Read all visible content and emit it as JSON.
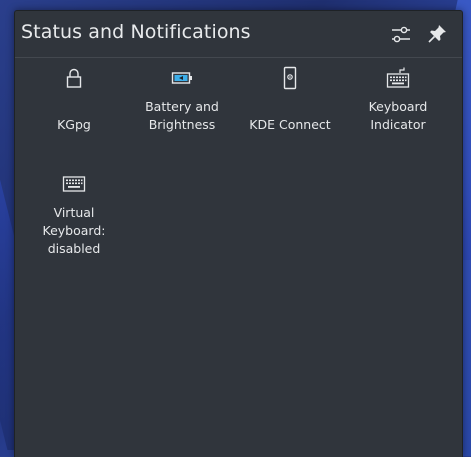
{
  "header": {
    "title": "Status and Notifications",
    "configure_icon": "configure-icon",
    "pin_icon": "pin-icon"
  },
  "items": [
    {
      "label": "KGpg",
      "icon": "lock-icon"
    },
    {
      "label": "Battery and Brightness",
      "icon": "battery-icon"
    },
    {
      "label": "KDE Connect",
      "icon": "smartphone-icon"
    },
    {
      "label": "Keyboard Indicator",
      "icon": "keyboard-icon"
    },
    {
      "label": "Virtual Keyboard: disabled",
      "icon": "virtual-keyboard-icon"
    }
  ],
  "colors": {
    "panel_background": "#30353c",
    "text": "#e6e8ea",
    "battery_accent": "#3daee9"
  }
}
